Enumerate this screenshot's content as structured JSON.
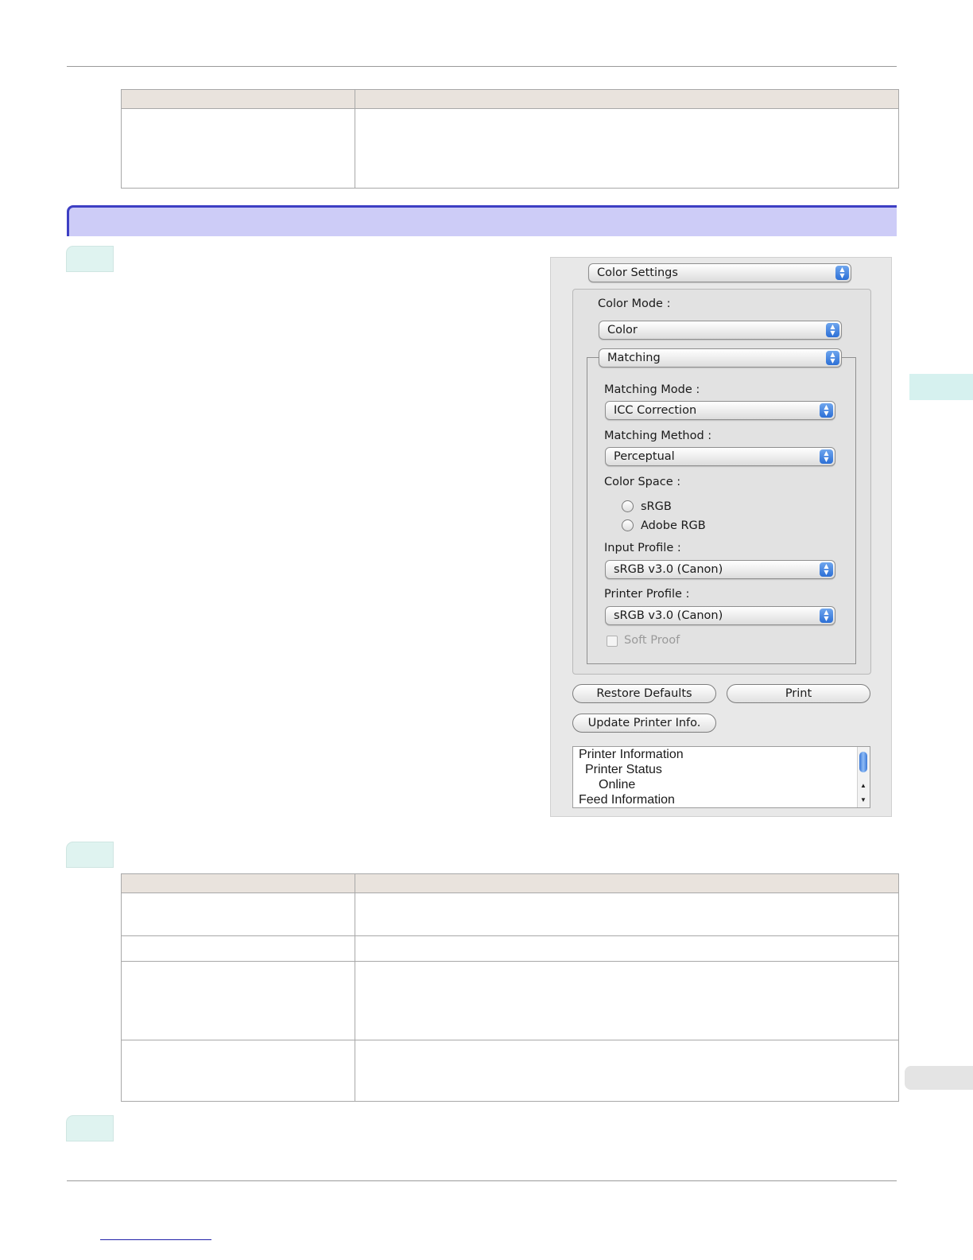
{
  "dialog": {
    "panel_popup": "Color Settings",
    "color_mode_label": "Color Mode :",
    "color_mode_value": "Color",
    "matching_popup": "Matching",
    "matching_mode_label": "Matching Mode :",
    "matching_mode_value": "ICC Correction",
    "matching_method_label": "Matching Method :",
    "matching_method_value": "Perceptual",
    "color_space_label": "Color Space :",
    "color_space_options": [
      "sRGB",
      "Adobe RGB"
    ],
    "input_profile_label": "Input Profile :",
    "input_profile_value": "sRGB v3.0 (Canon)",
    "printer_profile_label": "Printer Profile :",
    "printer_profile_value": "sRGB v3.0 (Canon)",
    "soft_proof_label": "Soft Proof",
    "restore_defaults_label": "Restore Defaults",
    "print_label": "Print",
    "update_printer_info_label": "Update Printer Info.",
    "printer_info_list": [
      "Printer Information",
      "Printer Status",
      "Online",
      "Feed Information"
    ],
    "arrow_glyph": "▲▼"
  },
  "colors": {
    "section_bar": "#cdccf7",
    "section_border": "#3d3fc3",
    "table_header": "#e9e3dd",
    "step_tab": "#dff3f0",
    "popup_arrow": "#2c6fd6"
  }
}
